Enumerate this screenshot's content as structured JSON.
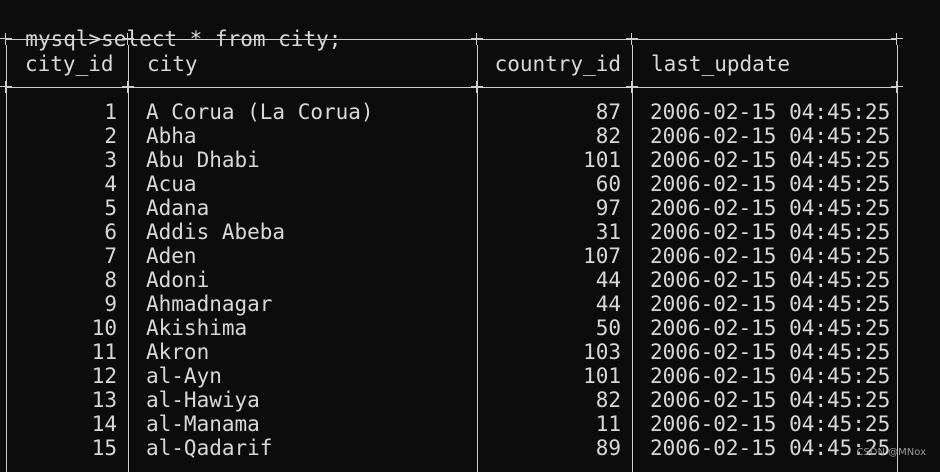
{
  "prompt": {
    "label": "mysql>",
    "command": "select * from city;"
  },
  "columns": [
    "city_id",
    "city",
    "country_id",
    "last_update"
  ],
  "rows": [
    [
      "1",
      "A Corua (La Corua)",
      "87",
      "2006-02-15 04:45:25"
    ],
    [
      "2",
      "Abha",
      "82",
      "2006-02-15 04:45:25"
    ],
    [
      "3",
      "Abu Dhabi",
      "101",
      "2006-02-15 04:45:25"
    ],
    [
      "4",
      "Acua",
      "60",
      "2006-02-15 04:45:25"
    ],
    [
      "5",
      "Adana",
      "97",
      "2006-02-15 04:45:25"
    ],
    [
      "6",
      "Addis Abeba",
      "31",
      "2006-02-15 04:45:25"
    ],
    [
      "7",
      "Aden",
      "107",
      "2006-02-15 04:45:25"
    ],
    [
      "8",
      "Adoni",
      "44",
      "2006-02-15 04:45:25"
    ],
    [
      "9",
      "Ahmadnagar",
      "44",
      "2006-02-15 04:45:25"
    ],
    [
      "10",
      "Akishima",
      "50",
      "2006-02-15 04:45:25"
    ],
    [
      "11",
      "Akron",
      "103",
      "2006-02-15 04:45:25"
    ],
    [
      "12",
      "al-Ayn",
      "101",
      "2006-02-15 04:45:25"
    ],
    [
      "13",
      "al-Hawiya",
      "82",
      "2006-02-15 04:45:25"
    ],
    [
      "14",
      "al-Manama",
      "11",
      "2006-02-15 04:45:25"
    ],
    [
      "15",
      "al-Qadarif",
      "89",
      "2006-02-15 04:45:25"
    ]
  ],
  "watermark": "CSDN @MNox",
  "colors": {
    "background": "#0c0c0c",
    "text": "#d8d8d8",
    "border": "#cfcfcf"
  }
}
